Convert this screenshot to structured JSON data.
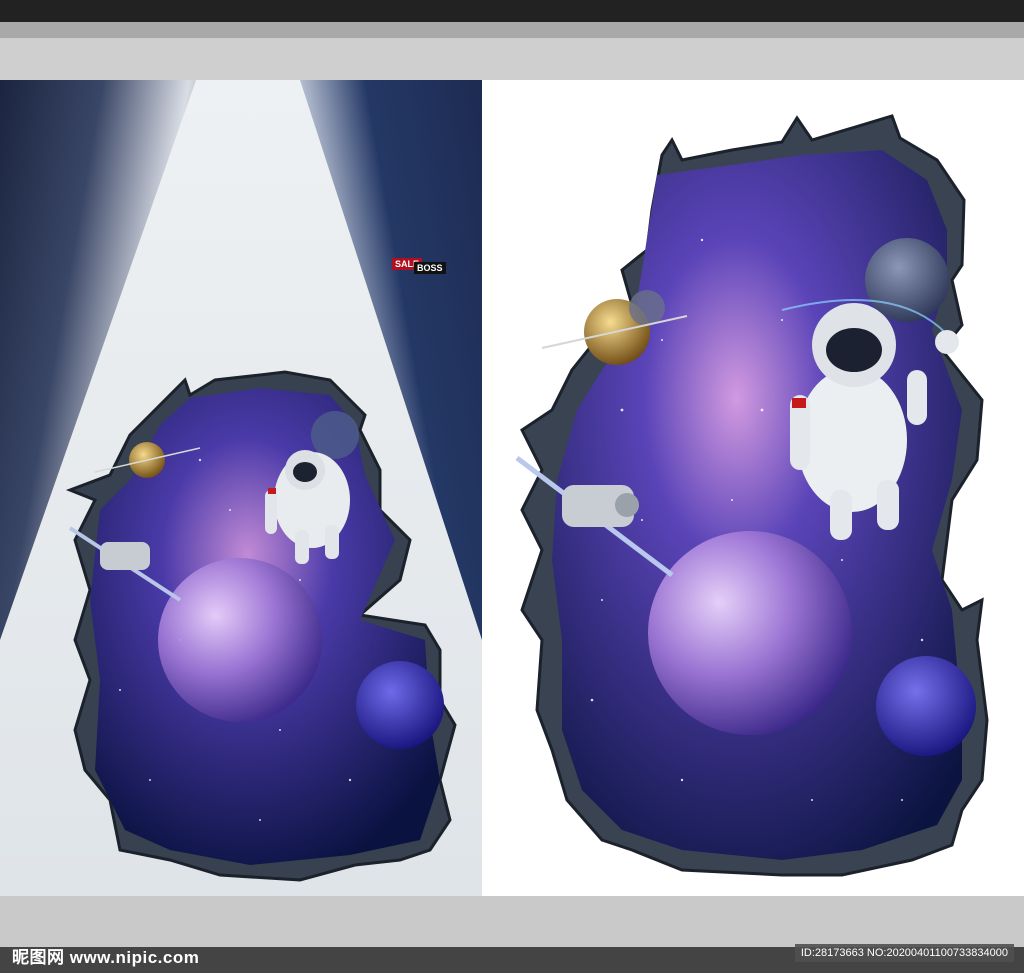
{
  "watermark": {
    "site_text": "昵图网 www.nipic.com",
    "id_text": "ID:28173663 NO:20200401100733834000"
  },
  "store_signs": {
    "boss": "BOSS",
    "sale": "SALE"
  },
  "colors": {
    "space_deep": "#0b1440",
    "space_mid": "#3b2f8f",
    "nebula": "#b47ad6",
    "rock": "#3a4352",
    "marble": "#e8ecef"
  }
}
